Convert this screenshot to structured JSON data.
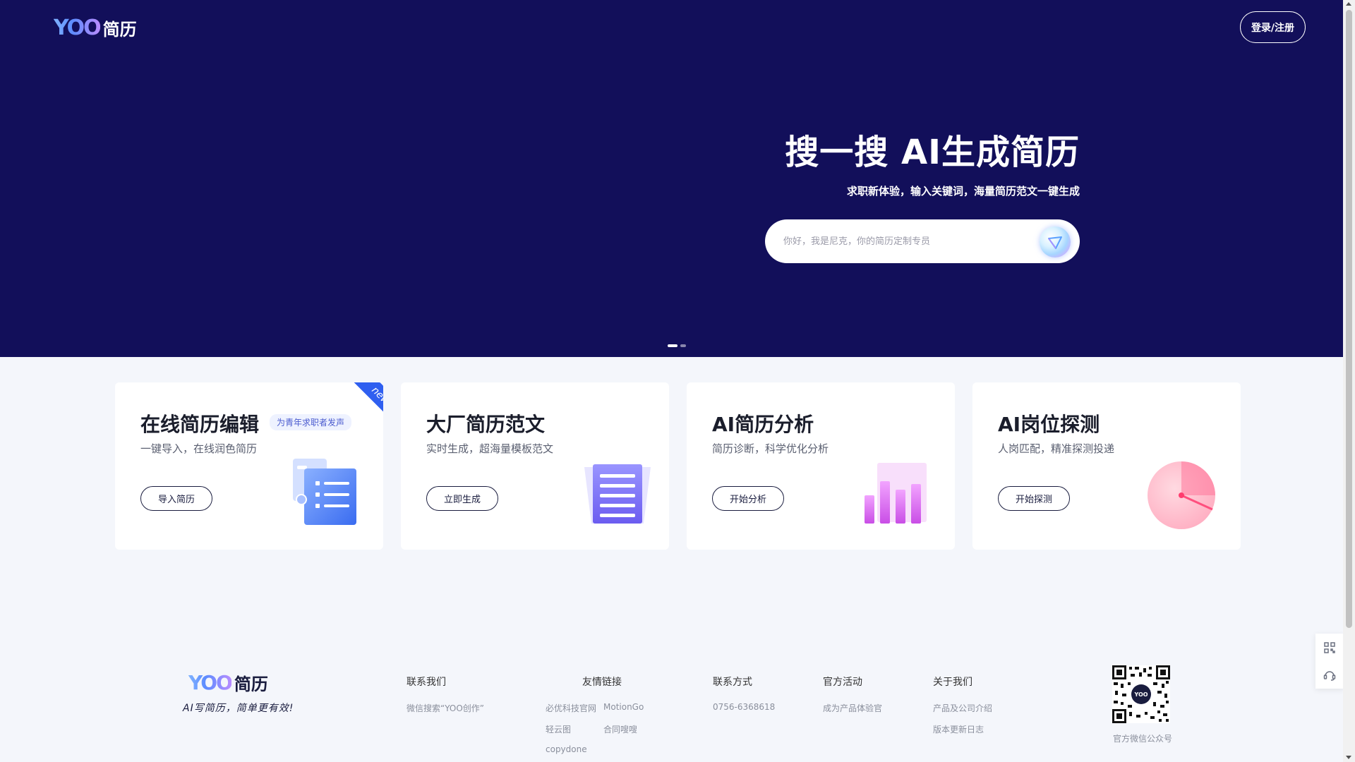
{
  "header": {
    "logo_mark": "YOO",
    "logo_text": "简历",
    "login_label": "登录/注册"
  },
  "hero": {
    "title": "搜一搜 AI生成简历",
    "subtitle": "求职新体验，输入关键词，海量简历范文一键生成",
    "search_placeholder": "你好，我是尼克，你的简历定制专员",
    "carousel_pages": 2,
    "carousel_active": 1
  },
  "cards": [
    {
      "title": "在线简历编辑",
      "tag": "为青年求职者发声",
      "desc": "一键导入，在线润色简历",
      "button": "导入简历",
      "ribbon": "new",
      "icon": "resume-list-icon"
    },
    {
      "title": "大厂简历范文",
      "desc": "实时生成，超海量模板范文",
      "button": "立即生成",
      "icon": "document-icon"
    },
    {
      "title": "AI简历分析",
      "desc": "简历诊断，科学优化分析",
      "button": "开始分析",
      "icon": "bar-chart-icon"
    },
    {
      "title": "AI岗位探测",
      "desc": "人岗匹配，精准探测投递",
      "button": "开始探测",
      "icon": "radar-icon"
    }
  ],
  "footer": {
    "logo_mark": "YOO",
    "logo_text": "简历",
    "slogan": "AI写简历，简单更有效!",
    "columns": [
      {
        "title": "联系我们",
        "links": [
          "微信搜索“YOO创作”"
        ]
      },
      {
        "title": "友情链接",
        "links": [
          "必优科技官网",
          "MotionGo",
          "轻云图",
          "合同嗖嗖",
          "copydone"
        ]
      },
      {
        "title": "联系方式",
        "links": [
          "0756-6368618"
        ]
      },
      {
        "title": "官方活动",
        "links": [
          "成为产品体验官"
        ]
      },
      {
        "title": "关于我们",
        "links": [
          "产品及公司介绍",
          "版本更新日志"
        ]
      }
    ],
    "qr_center": "YOO",
    "qr_caption": "官方微信公众号"
  },
  "colors": {
    "hero_bg": "#120f5a",
    "accent_blue": "#2f5ff0",
    "brand_dark": "#1a1d3f"
  }
}
